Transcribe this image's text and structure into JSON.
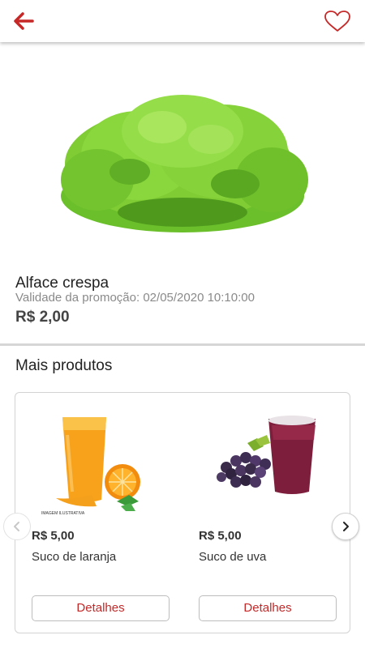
{
  "header": {
    "back_icon": "arrow-left-icon",
    "favorite_icon": "heart-outline-icon",
    "accent_color": "#c62828"
  },
  "product": {
    "name": "Alface crespa",
    "promo_label": "Validade da promoção:",
    "promo_date": "02/05/2020 10:10:00",
    "price": "R$ 2,00",
    "image_icon": "lettuce-image"
  },
  "more": {
    "title": "Mais produtos",
    "items": [
      {
        "price": "R$ 5,00",
        "name": "Suco de laranja",
        "button": "Detalhes",
        "image_caption": "IMAGEM ILUSTRATIVA"
      },
      {
        "price": "R$ 5,00",
        "name": "Suco de uva",
        "button": "Detalhes"
      }
    ]
  }
}
